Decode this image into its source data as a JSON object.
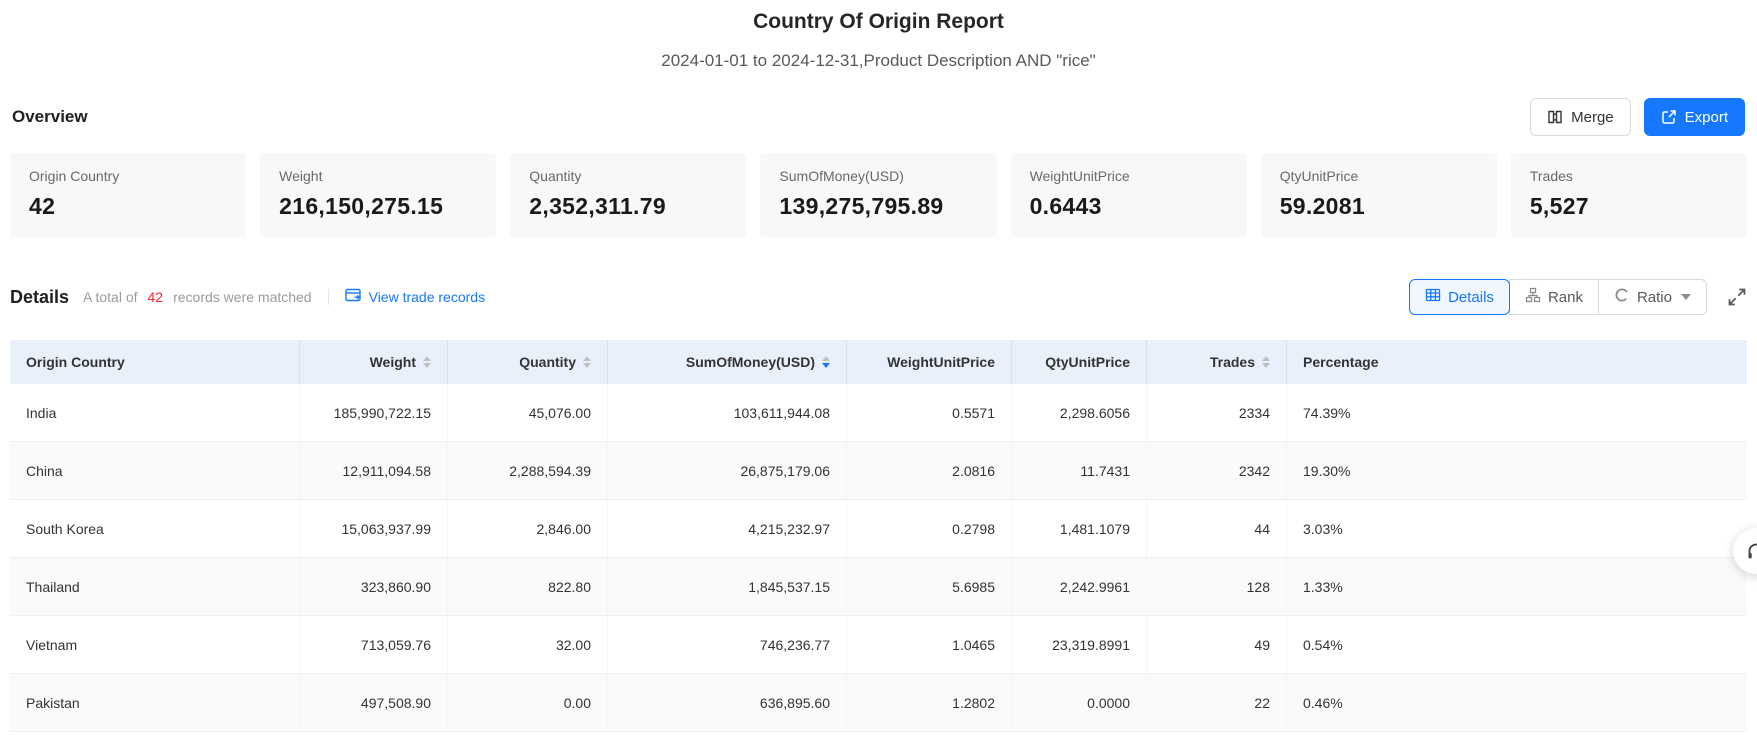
{
  "report": {
    "title": "Country Of Origin Report",
    "subtitle": "2024-01-01 to 2024-12-31,Product Description AND \"rice\""
  },
  "overview": {
    "heading": "Overview",
    "buttons": {
      "merge": "Merge",
      "export": "Export"
    },
    "cards": [
      {
        "label": "Origin Country",
        "value": "42"
      },
      {
        "label": "Weight",
        "value": "216,150,275.15"
      },
      {
        "label": "Quantity",
        "value": "2,352,311.79"
      },
      {
        "label": "SumOfMoney(USD)",
        "value": "139,275,795.89"
      },
      {
        "label": "WeightUnitPrice",
        "value": "0.6443"
      },
      {
        "label": "QtyUnitPrice",
        "value": "59.2081"
      },
      {
        "label": "Trades",
        "value": "5,527"
      }
    ]
  },
  "details": {
    "heading": "Details",
    "total_prefix": "A total of",
    "matched_count": "42",
    "total_suffix": "records were matched",
    "trade_link": "View trade records",
    "views": {
      "details": "Details",
      "rank": "Rank",
      "ratio": "Ratio"
    }
  },
  "table": {
    "columns": [
      {
        "label": "Origin Country",
        "align": "left",
        "sortable": false,
        "sort": null
      },
      {
        "label": "Weight",
        "align": "right",
        "sortable": true,
        "sort": null
      },
      {
        "label": "Quantity",
        "align": "right",
        "sortable": true,
        "sort": null
      },
      {
        "label": "SumOfMoney(USD)",
        "align": "right",
        "sortable": true,
        "sort": "desc"
      },
      {
        "label": "WeightUnitPrice",
        "align": "right",
        "sortable": false,
        "sort": null
      },
      {
        "label": "QtyUnitPrice",
        "align": "right",
        "sortable": false,
        "sort": null
      },
      {
        "label": "Trades",
        "align": "right",
        "sortable": true,
        "sort": null
      },
      {
        "label": "Percentage",
        "align": "left",
        "sortable": false,
        "sort": null
      }
    ],
    "rows": [
      [
        "India",
        "185,990,722.15",
        "45,076.00",
        "103,611,944.08",
        "0.5571",
        "2,298.6056",
        "2334",
        "74.39%"
      ],
      [
        "China",
        "12,911,094.58",
        "2,288,594.39",
        "26,875,179.06",
        "2.0816",
        "11.7431",
        "2342",
        "19.30%"
      ],
      [
        "South Korea",
        "15,063,937.99",
        "2,846.00",
        "4,215,232.97",
        "0.2798",
        "1,481.1079",
        "44",
        "3.03%"
      ],
      [
        "Thailand",
        "323,860.90",
        "822.80",
        "1,845,537.15",
        "5.6985",
        "2,242.9961",
        "128",
        "1.33%"
      ],
      [
        "Vietnam",
        "713,059.76",
        "32.00",
        "746,236.77",
        "1.0465",
        "23,319.8991",
        "49",
        "0.54%"
      ],
      [
        "Pakistan",
        "497,508.90",
        "0.00",
        "636,895.60",
        "1.2802",
        "0.0000",
        "22",
        "0.46%"
      ]
    ]
  },
  "colors": {
    "accent_blue": "#1677ff",
    "count_red": "#f5222d",
    "table_header_bg": "#e8f0fc"
  }
}
